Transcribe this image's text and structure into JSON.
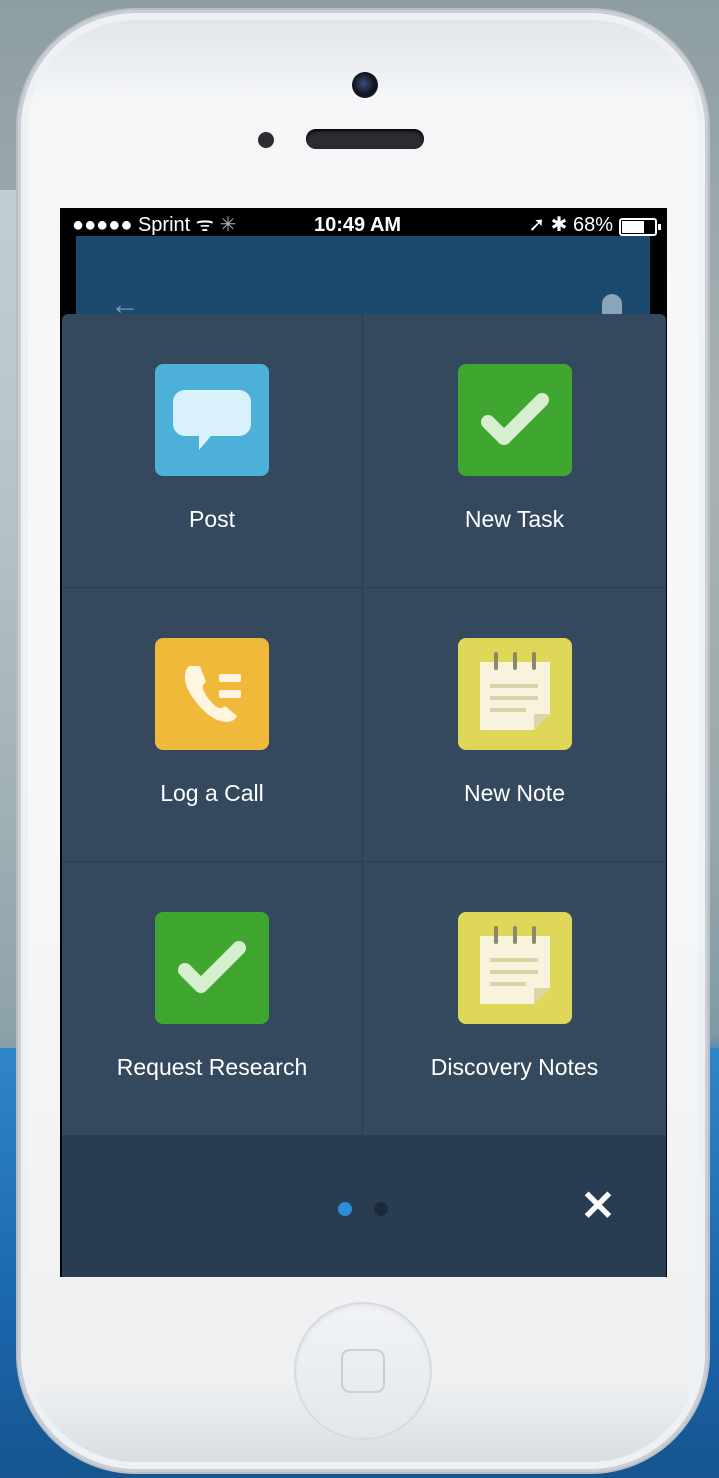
{
  "status_bar": {
    "carrier": "●●●●● Sprint",
    "time": "10:49 AM",
    "battery": "68%"
  },
  "actions": [
    {
      "label": "Post",
      "icon": "speech-bubble-icon",
      "color": "#4db0d8"
    },
    {
      "label": "New Task",
      "icon": "checkmark-icon",
      "color": "#3fa62f"
    },
    {
      "label": "Log a Call",
      "icon": "phone-icon",
      "color": "#f1b93a"
    },
    {
      "label": "New Note",
      "icon": "notepad-icon",
      "color": "#dfd757"
    },
    {
      "label": "Request Research",
      "icon": "checkmark-icon",
      "color": "#3fa62f"
    },
    {
      "label": "Discovery Notes",
      "icon": "notepad-icon",
      "color": "#dfd757"
    }
  ],
  "pagination": {
    "current": 1,
    "total": 2
  },
  "colors": {
    "panel": "#34495e",
    "footer": "#283c52",
    "active_dot": "#2e8ddb"
  }
}
